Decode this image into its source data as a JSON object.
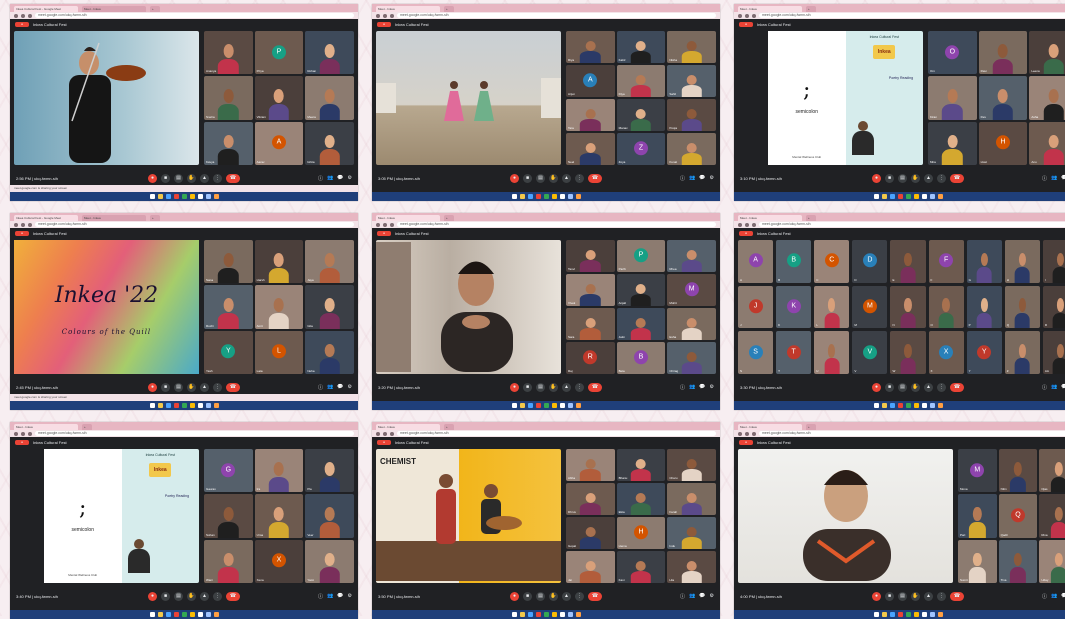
{
  "panels": [
    {
      "id": "violin",
      "tabs": [
        "Inkea Cultural Fest - Google Meet",
        "Meet - Inkea",
        "+"
      ],
      "url": "meet.google.com/ukq-fwmn-sih",
      "meeting_title": "Inkea Cultural Fest",
      "time_label": "2:56 PM | ukq-fwmn-sih",
      "notif": "meet.google.com is sharing your screen",
      "accent": "#ea4335",
      "tile_names": [
        "Ananya",
        "Priya",
        "Rohan",
        "Sneha",
        "Vikram",
        "Meera",
        "Kavya",
        "Aarav",
        "Ishita"
      ]
    },
    {
      "id": "dance",
      "tabs": [
        "Meet - Inkea",
        "+"
      ],
      "url": "meet.google.com/ukq-fwmn-sih",
      "meeting_title": "Inkea Cultural Fest",
      "time_label": "3:05 PM | ukq-fwmn-sih",
      "tile_names": [
        "Riya",
        "Kabir",
        "Nisha",
        "Arjun",
        "Diya",
        "Sahil",
        "Tara",
        "Manav",
        "Pooja",
        "Neel",
        "Zoya",
        "Kunal"
      ]
    },
    {
      "id": "semicolon1",
      "tabs": [
        "Meet - Inkea",
        "+"
      ],
      "url": "meet.google.com/ukq-fwmn-sih",
      "meeting_title": "Inkea Cultural Fest",
      "time_label": "3:10 PM | ukq-fwmn-sih",
      "slide": {
        "symbol": ";",
        "brand": "semicolon",
        "footer": "Mental Wellness Club",
        "header": "Inkea Cultural Fest",
        "badge": "Inkea",
        "caption": "Poetry Reading"
      },
      "tile_names": [
        "Om",
        "Ravi",
        "Leena",
        "Kiran",
        "Dev",
        "Asha",
        "Mira",
        "Host",
        "Anu"
      ]
    },
    {
      "id": "inkea",
      "tabs": [
        "Inkea Cultural Fest - Google Meet",
        "Meet - Inkea",
        "+"
      ],
      "url": "meet.google.com/ukq-fwmn-sih",
      "meeting_title": "Inkea Cultural Fest",
      "time_label": "2:45 PM | ukq-fwmn-sih",
      "title": "Inkea '22",
      "subtitle": "Colours of the Quill",
      "notif": "meet.google.com is sharing your screen",
      "tile_names": [
        "Sana",
        "Harsh",
        "Jaya",
        "Ruchi",
        "Amit",
        "Gita",
        "Yash",
        "Lata",
        "Neha"
      ]
    },
    {
      "id": "speaker1",
      "tabs": [
        "Meet - Inkea",
        "+"
      ],
      "url": "meet.google.com/ukq-fwmn-sih",
      "meeting_title": "Inkea Cultural Fest",
      "time_label": "3:20 PM | ukq-fwmn-sih",
      "tile_names": [
        "Tanvi",
        "Parth",
        "Rhea",
        "Vivek",
        "Anjali",
        "Mohit",
        "Sara",
        "Jatin",
        "Esha",
        "Raj",
        "Bela",
        "Chirag"
      ]
    },
    {
      "id": "gallery",
      "tabs": [
        "Meet - Inkea",
        "+"
      ],
      "url": "meet.google.com/ukq-fwmn-sih",
      "meeting_title": "Inkea Cultural Fest",
      "time_label": "3:30 PM | ukq-fwmn-sih",
      "tile_names": [
        "A",
        "B",
        "C",
        "D",
        "E",
        "F",
        "G",
        "H",
        "I",
        "J",
        "K",
        "L",
        "M",
        "N",
        "O",
        "P",
        "Q",
        "R",
        "S",
        "T",
        "U",
        "V",
        "W",
        "X",
        "Y",
        "Z",
        "AA"
      ]
    },
    {
      "id": "semicolon2",
      "tabs": [
        "Meet - Inkea",
        "+"
      ],
      "url": "meet.google.com/ukq-fwmn-sih",
      "meeting_title": "Inkea Cultural Fest",
      "time_label": "3:40 PM | ukq-fwmn-sih",
      "slide": {
        "symbol": ";",
        "brand": "semicolon",
        "footer": "Mental Wellness Club",
        "header": "Inkea Cultural Fest",
        "badge": "Inkea",
        "caption": "Poetry Reading"
      },
      "tile_names": [
        "Gaurav",
        "Ira",
        "Pia",
        "Sohan",
        "Uma",
        "Veer",
        "Wani",
        "Xena",
        "Yami"
      ]
    },
    {
      "id": "chemist",
      "tabs": [
        "Meet - Inkea",
        "+"
      ],
      "url": "meet.google.com/ukq-fwmn-sih",
      "meeting_title": "Inkea Cultural Fest",
      "time_label": "3:50 PM | ukq-fwmn-sih",
      "wall_text": "CHEMIST",
      "tile_names": [
        "Abha",
        "Bhanu",
        "Charu",
        "Dhruv",
        "Ekta",
        "Farah",
        "Gopal",
        "Hema",
        "Indu",
        "Jai",
        "Kavi",
        "Lila"
      ]
    },
    {
      "id": "speaker2",
      "tabs": [
        "Meet - Inkea",
        "+"
      ],
      "url": "meet.google.com/ukq-fwmn-sih",
      "meeting_title": "Inkea Cultural Fest",
      "time_label": "4:00 PM | ukq-fwmn-sih",
      "tile_names": [
        "Mona",
        "Nitin",
        "Ojas",
        "Pari",
        "Qadir",
        "Rina",
        "Sumit",
        "Tina",
        "Uday"
      ]
    }
  ],
  "control_icons": [
    "mic-icon",
    "camera-icon",
    "captions-icon",
    "hand-icon",
    "present-icon",
    "more-icon",
    "end-call-icon"
  ]
}
